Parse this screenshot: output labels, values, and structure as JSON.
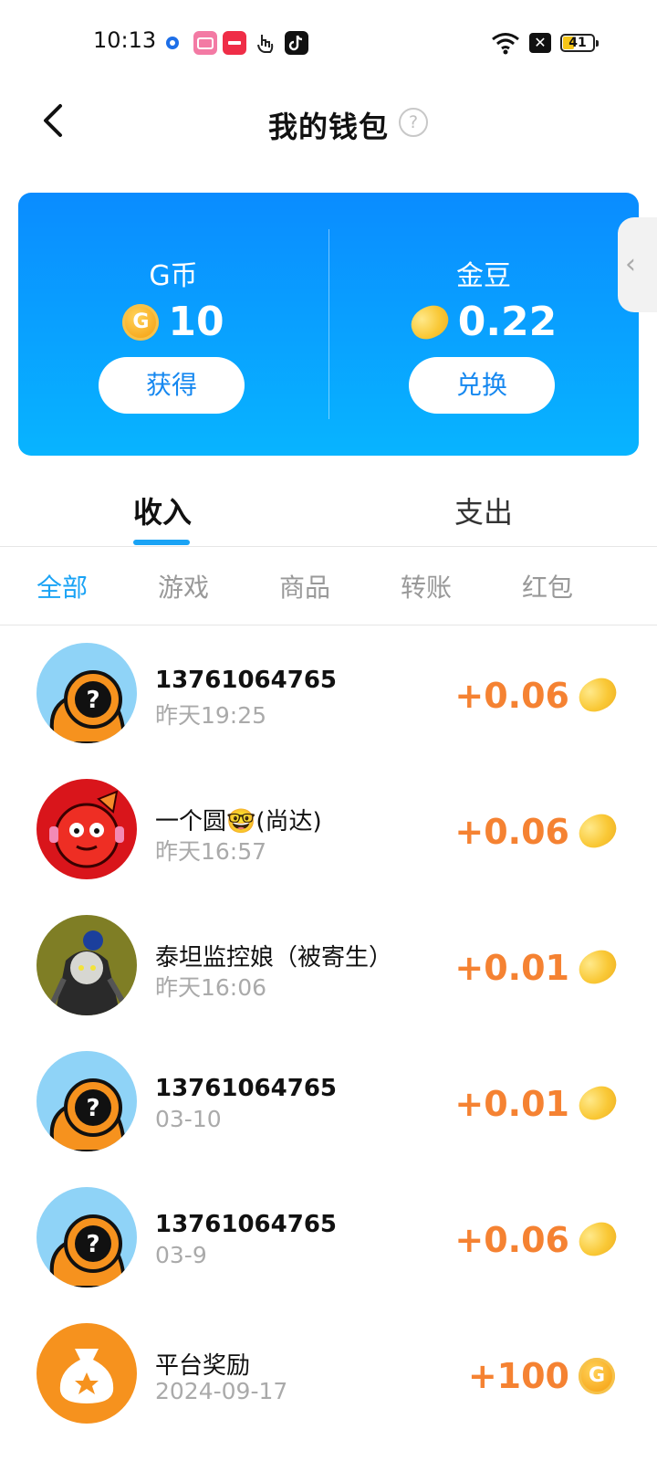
{
  "status_bar": {
    "time": "10:13",
    "battery": "41"
  },
  "header": {
    "title": "我的钱包",
    "help_symbol": "?"
  },
  "wallet": {
    "g_coin": {
      "label": "G币",
      "value": "10",
      "icon_letter": "G",
      "button": "获得"
    },
    "gold_bean": {
      "label": "金豆",
      "value": "0.22",
      "button": "兑换"
    }
  },
  "tabs": [
    {
      "label": "收入",
      "active": true
    },
    {
      "label": "支出",
      "active": false
    }
  ],
  "filters": [
    {
      "label": "全部",
      "active": true
    },
    {
      "label": "游戏",
      "active": false
    },
    {
      "label": "商品",
      "active": false
    },
    {
      "label": "转账",
      "active": false
    },
    {
      "label": "红包",
      "active": false
    }
  ],
  "transactions": [
    {
      "name": "13761064765",
      "date": "昨天19:25",
      "amount": "+0.06",
      "currency_icon": "gold-bean",
      "avatar": "unknown-user"
    },
    {
      "name": "一个圆🤓(尚达)",
      "date": "昨天16:57",
      "amount": "+0.06",
      "currency_icon": "gold-bean",
      "avatar": "red-character"
    },
    {
      "name": "泰坦监控娘（被寄生）",
      "date": "昨天16:06",
      "amount": "+0.01",
      "currency_icon": "gold-bean",
      "avatar": "dark-character"
    },
    {
      "name": "13761064765",
      "date": "03-10",
      "amount": "+0.01",
      "currency_icon": "gold-bean",
      "avatar": "unknown-user"
    },
    {
      "name": "13761064765",
      "date": "03-9",
      "amount": "+0.06",
      "currency_icon": "gold-bean",
      "avatar": "unknown-user"
    },
    {
      "name": "平台奖励",
      "date": "2024-09-17",
      "amount": "+100",
      "currency_icon": "g-coin",
      "avatar": "platform-reward"
    }
  ],
  "colors": {
    "accent": "#1aa3f5",
    "amount": "#f58232",
    "card_top": "#0a8cff",
    "card_bottom": "#08b4ff"
  }
}
